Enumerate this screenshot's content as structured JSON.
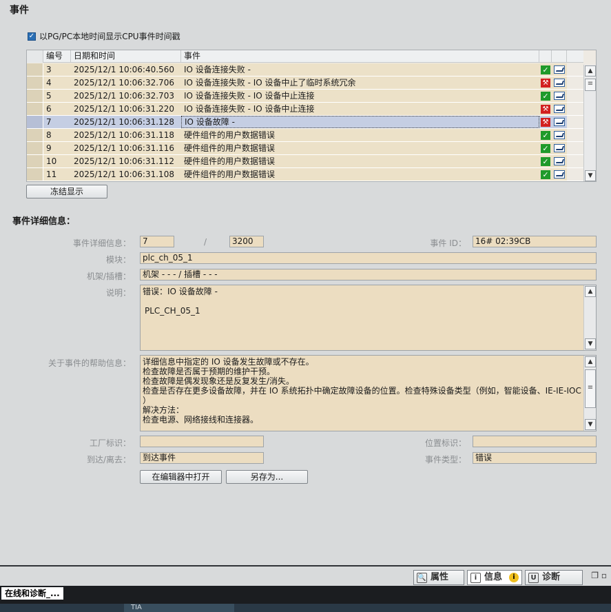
{
  "page": {
    "title": "事件"
  },
  "option": {
    "checked": true,
    "label": "以PG/PC本地时间显示CPU事件时间戳"
  },
  "table": {
    "headers": [
      "编号",
      "日期和时间",
      "事件"
    ],
    "rows": [
      {
        "no": "3",
        "time": "2025/12/1 10:06:40.560",
        "event": "IO 设备连接失败 -",
        "status": "ok",
        "selected": false
      },
      {
        "no": "4",
        "time": "2025/12/1 10:06:32.706",
        "event": "IO 设备连接失败 - IO 设备中止了临时系统冗余",
        "status": "error",
        "selected": false
      },
      {
        "no": "5",
        "time": "2025/12/1 10:06:32.703",
        "event": "IO 设备连接失败 - IO 设备中止连接",
        "status": "ok",
        "selected": false
      },
      {
        "no": "6",
        "time": "2025/12/1 10:06:31.220",
        "event": "IO 设备连接失败 - IO 设备中止连接",
        "status": "error",
        "selected": false
      },
      {
        "no": "7",
        "time": "2025/12/1 10:06:31.128",
        "event": "IO 设备故障 -",
        "status": "error",
        "selected": true
      },
      {
        "no": "8",
        "time": "2025/12/1 10:06:31.118",
        "event": "硬件组件的用户数据错误",
        "status": "ok",
        "selected": false
      },
      {
        "no": "9",
        "time": "2025/12/1 10:06:31.116",
        "event": "硬件组件的用户数据错误",
        "status": "ok",
        "selected": false
      },
      {
        "no": "10",
        "time": "2025/12/1 10:06:31.112",
        "event": "硬件组件的用户数据错误",
        "status": "ok",
        "selected": false
      },
      {
        "no": "11",
        "time": "2025/12/1 10:06:31.108",
        "event": "硬件组件的用户数据错误",
        "status": "ok",
        "selected": false
      }
    ]
  },
  "buttons": {
    "freeze": "冻结显示",
    "open_editor": "在编辑器中打开",
    "save_as": "另存为..."
  },
  "details": {
    "title": "事件详细信息：",
    "labels": {
      "detail": "事件详细信息：",
      "event_id": "事件 ID：",
      "module": "模块：",
      "rack_slot": "机架/插槽：",
      "description": "说明：",
      "help": "关于事件的帮助信息：",
      "plant_id": "工厂标识：",
      "location_id": "位置标识：",
      "coming_going": "到达/离去：",
      "event_type": "事件类型："
    },
    "detail_no": "7",
    "slash": "/",
    "detail_total": "3200",
    "event_id": "16# 02:39CB",
    "module": "plc_ch_05_1",
    "rack_slot": "机架 - - - / 插槽 - - -",
    "description_line1": "错误：IO 设备故障 -",
    "description_line2": "PLC_CH_05_1",
    "help_lines": [
      "详细信息中指定的 IO 设备发生故障或不存在。",
      "检查故障是否属于预期的维护干预。",
      "检查故障是偶发现象还是反复发生/消失。",
      "检查是否存在更多设备故障，并在 IO 系统拓扑中确定故障设备的位置。检查特殊设备类型（例如，智能设备、IE-IE-IOC",
      "）",
      "解决方法：",
      "检查电源、网络接线和连接器。"
    ],
    "plant_id": "",
    "location_id": "",
    "coming_going": "到达事件",
    "event_type": "错误"
  },
  "tabs": {
    "properties": "属性",
    "info": "信息",
    "diagnostics": "诊断"
  },
  "footer": {
    "tab": "在线和诊断_...",
    "tia": "TIA"
  }
}
